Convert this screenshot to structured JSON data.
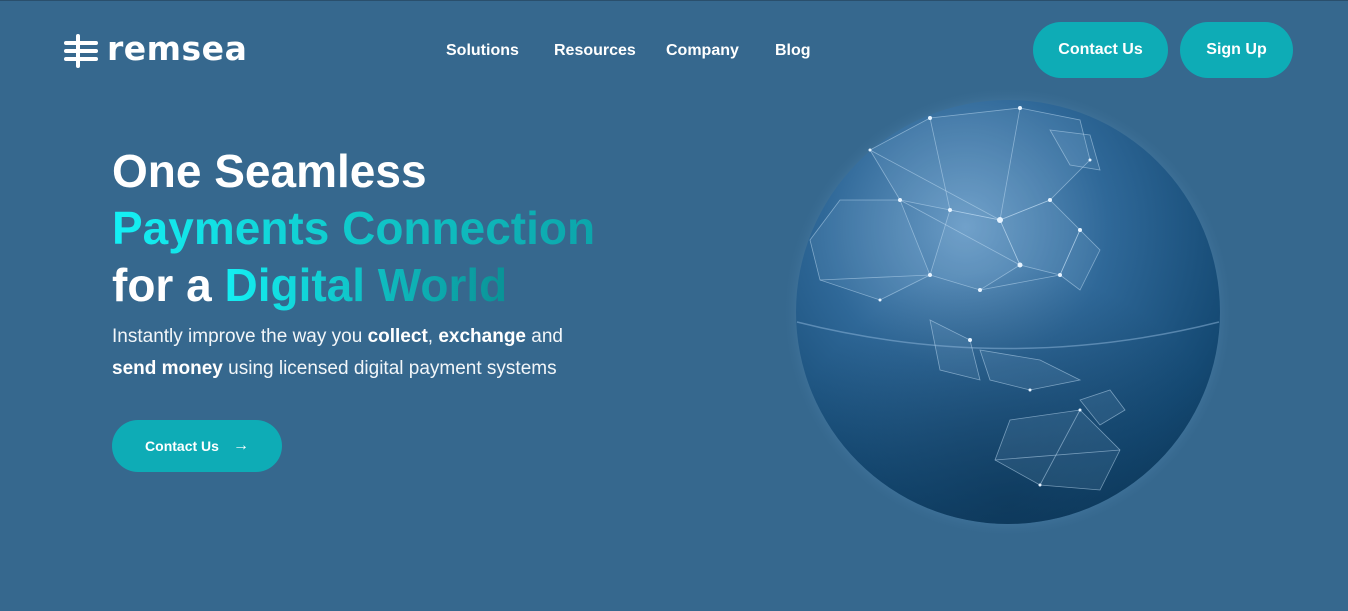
{
  "header": {
    "logo_text": "remsea",
    "nav": [
      "Solutions",
      "Resources",
      "Company",
      "Blog"
    ],
    "contact_label": "Contact Us",
    "signup_label": "Sign Up"
  },
  "hero": {
    "line1": "One Seamless",
    "line2": "Payments Connection",
    "line3_prefix": "for a ",
    "line3_highlight": "Digital World",
    "sub_1": "Instantly improve the way you ",
    "sub_collect": "collect",
    "sub_2": ", ",
    "sub_exchange": "exchange",
    "sub_3": " and",
    "sub_send": "send money",
    "sub_4": " using licensed digital payment systems",
    "cta_label": "Contact Us",
    "cta_arrow": "→"
  },
  "colors": {
    "background": "#36688e",
    "accent": "#0eacb6",
    "highlight_start": "#14f0f5",
    "highlight_end": "#0b9aa0"
  },
  "icons": [
    "remsea-logo-icon",
    "arrow-right-icon",
    "globe-illustration"
  ]
}
